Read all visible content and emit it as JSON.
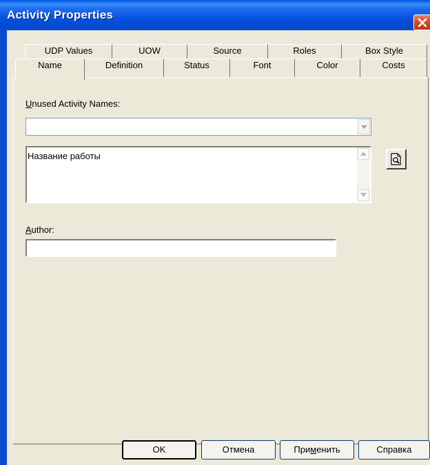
{
  "window": {
    "title": "Activity Properties"
  },
  "tabs_back": [
    "UDP Values",
    "UOW",
    "Source",
    "Roles",
    "Box Style"
  ],
  "tabs_front": [
    "Name",
    "Definition",
    "Status",
    "Font",
    "Color",
    "Costs"
  ],
  "selected_tab": "Name",
  "name_tab": {
    "unused_names_label_u": "U",
    "unused_names_label_rest": "nused Activity Names:",
    "unused_names_value": "",
    "activity_name": "Название работы",
    "author_label_u": "A",
    "author_label_rest": "uthor:",
    "author_value": ""
  },
  "buttons": {
    "ok": "OK",
    "cancel": "Отмена",
    "apply_pre": "При",
    "apply_u": "м",
    "apply_post": "енить",
    "help": "Справка"
  },
  "icons": [
    "close-icon",
    "dropdown-arrow-icon",
    "scroll-up-icon",
    "scroll-down-icon",
    "preview-icon"
  ],
  "colors": {
    "titlebar": "#0a5fe8",
    "dialog_bg": "#ece9d8",
    "close": "#d6431f"
  }
}
